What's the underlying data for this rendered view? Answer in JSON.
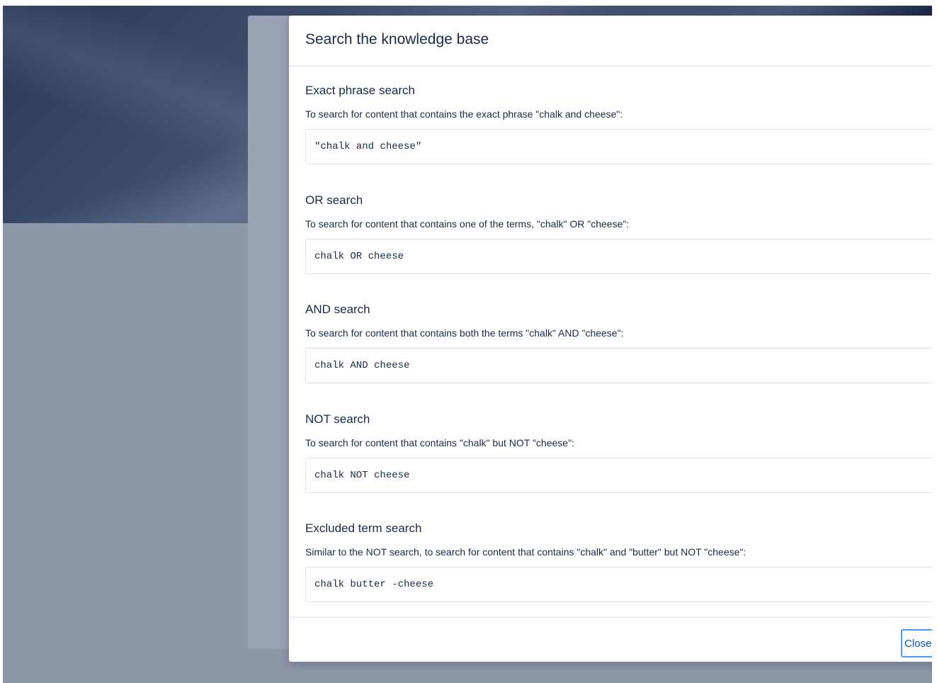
{
  "dialog": {
    "title": "Search the knowledge base",
    "close_label": "Close"
  },
  "sections": [
    {
      "heading": "Exact phrase search",
      "description": "To search for content that contains the exact phrase \"chalk and cheese\":",
      "example": "\"chalk and cheese\""
    },
    {
      "heading": "OR search",
      "description": "To search for content that contains one of the terms, \"chalk\" OR \"cheese\":",
      "example": "chalk OR cheese"
    },
    {
      "heading": "AND search",
      "description": "To search for content that contains both the terms \"chalk\" AND \"cheese\":",
      "example": "chalk AND cheese"
    },
    {
      "heading": "NOT search",
      "description": "To search for content that contains \"chalk\" but NOT \"cheese\":",
      "example": "chalk NOT cheese"
    },
    {
      "heading": "Excluded term search",
      "description": "Similar to the NOT search, to search for content that contains \"chalk\" and \"butter\" but NOT \"cheese\":",
      "example": "chalk butter -cheese"
    }
  ],
  "colors": {
    "text": "#172b4d",
    "link": "#0052cc",
    "focus_ring": "#4c9aff",
    "overlay": "#8e97a8"
  }
}
